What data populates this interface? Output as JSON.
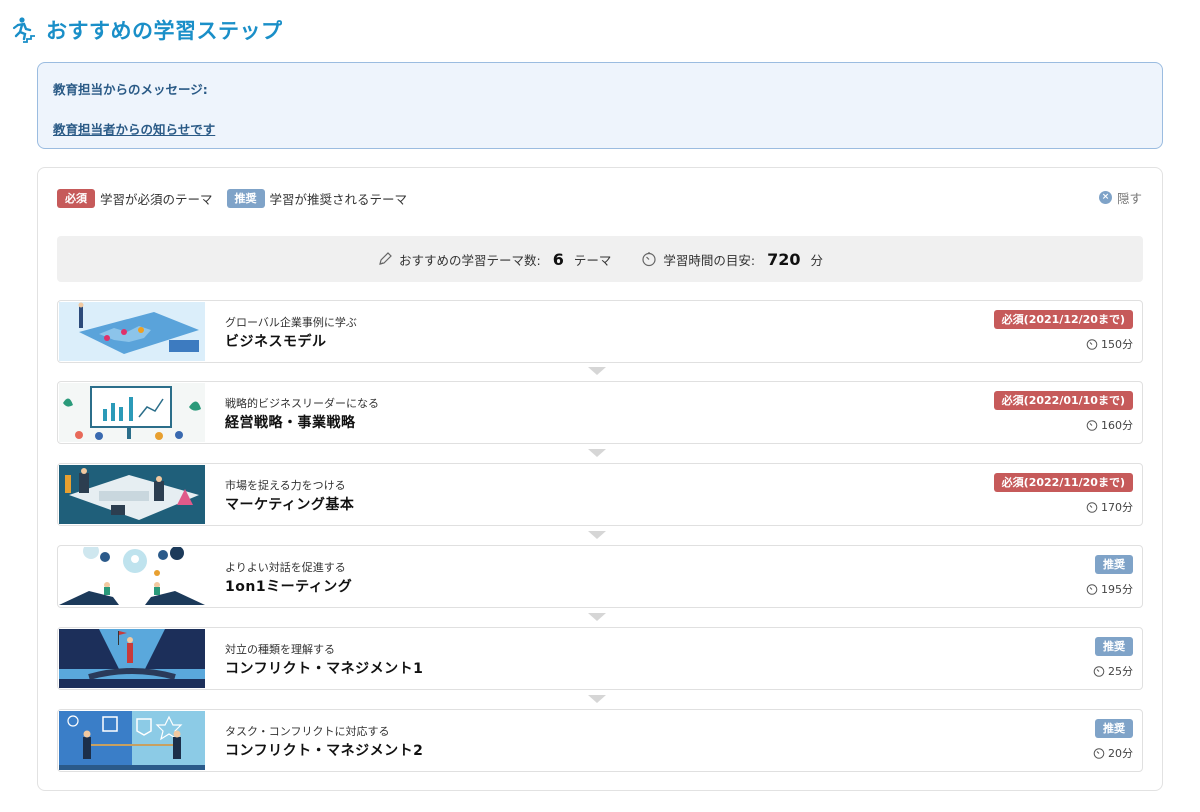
{
  "header": {
    "icon": "runner-stairs-icon",
    "title": "おすすめの学習ステップ"
  },
  "message": {
    "label": "教育担当からのメッセージ:",
    "link_text": "教育担当者からの知らせです"
  },
  "legend": {
    "required_badge": "必須",
    "required_text": "学習が必須のテーマ",
    "recommended_badge": "推奨",
    "recommended_text": "学習が推奨されるテーマ",
    "hide_label": "隠す"
  },
  "summary": {
    "theme_count_label": "おすすめの学習テーマ数:",
    "theme_count": "6",
    "theme_unit": "テーマ",
    "time_label": "学習時間の目安:",
    "time_value": "720",
    "time_unit": "分"
  },
  "colors": {
    "accent": "#1a8fc8",
    "required": "#c65a5a",
    "recommended": "#7fa3c8"
  },
  "steps": [
    {
      "subtitle": "グローバル企業事例に学ぶ",
      "title": "ビジネスモデル",
      "badge": "必須(2021/12/20まで)",
      "badge_type": "required",
      "duration": "150分"
    },
    {
      "subtitle": "戦略的ビジネスリーダーになる",
      "title": "経営戦略・事業戦略",
      "badge": "必須(2022/01/10まで)",
      "badge_type": "required",
      "duration": "160分"
    },
    {
      "subtitle": "市場を捉える力をつける",
      "title": "マーケティング基本",
      "badge": "必須(2022/11/20まで)",
      "badge_type": "required",
      "duration": "170分"
    },
    {
      "subtitle": "よりよい対話を促進する",
      "title": "1on1ミーティング",
      "badge": "推奨",
      "badge_type": "recommended",
      "duration": "195分"
    },
    {
      "subtitle": "対立の種類を理解する",
      "title": "コンフリクト・マネジメント1",
      "badge": "推奨",
      "badge_type": "recommended",
      "duration": "25分"
    },
    {
      "subtitle": "タスク・コンフリクトに対応する",
      "title": "コンフリクト・マネジメント2",
      "badge": "推奨",
      "badge_type": "recommended",
      "duration": "20分"
    }
  ]
}
